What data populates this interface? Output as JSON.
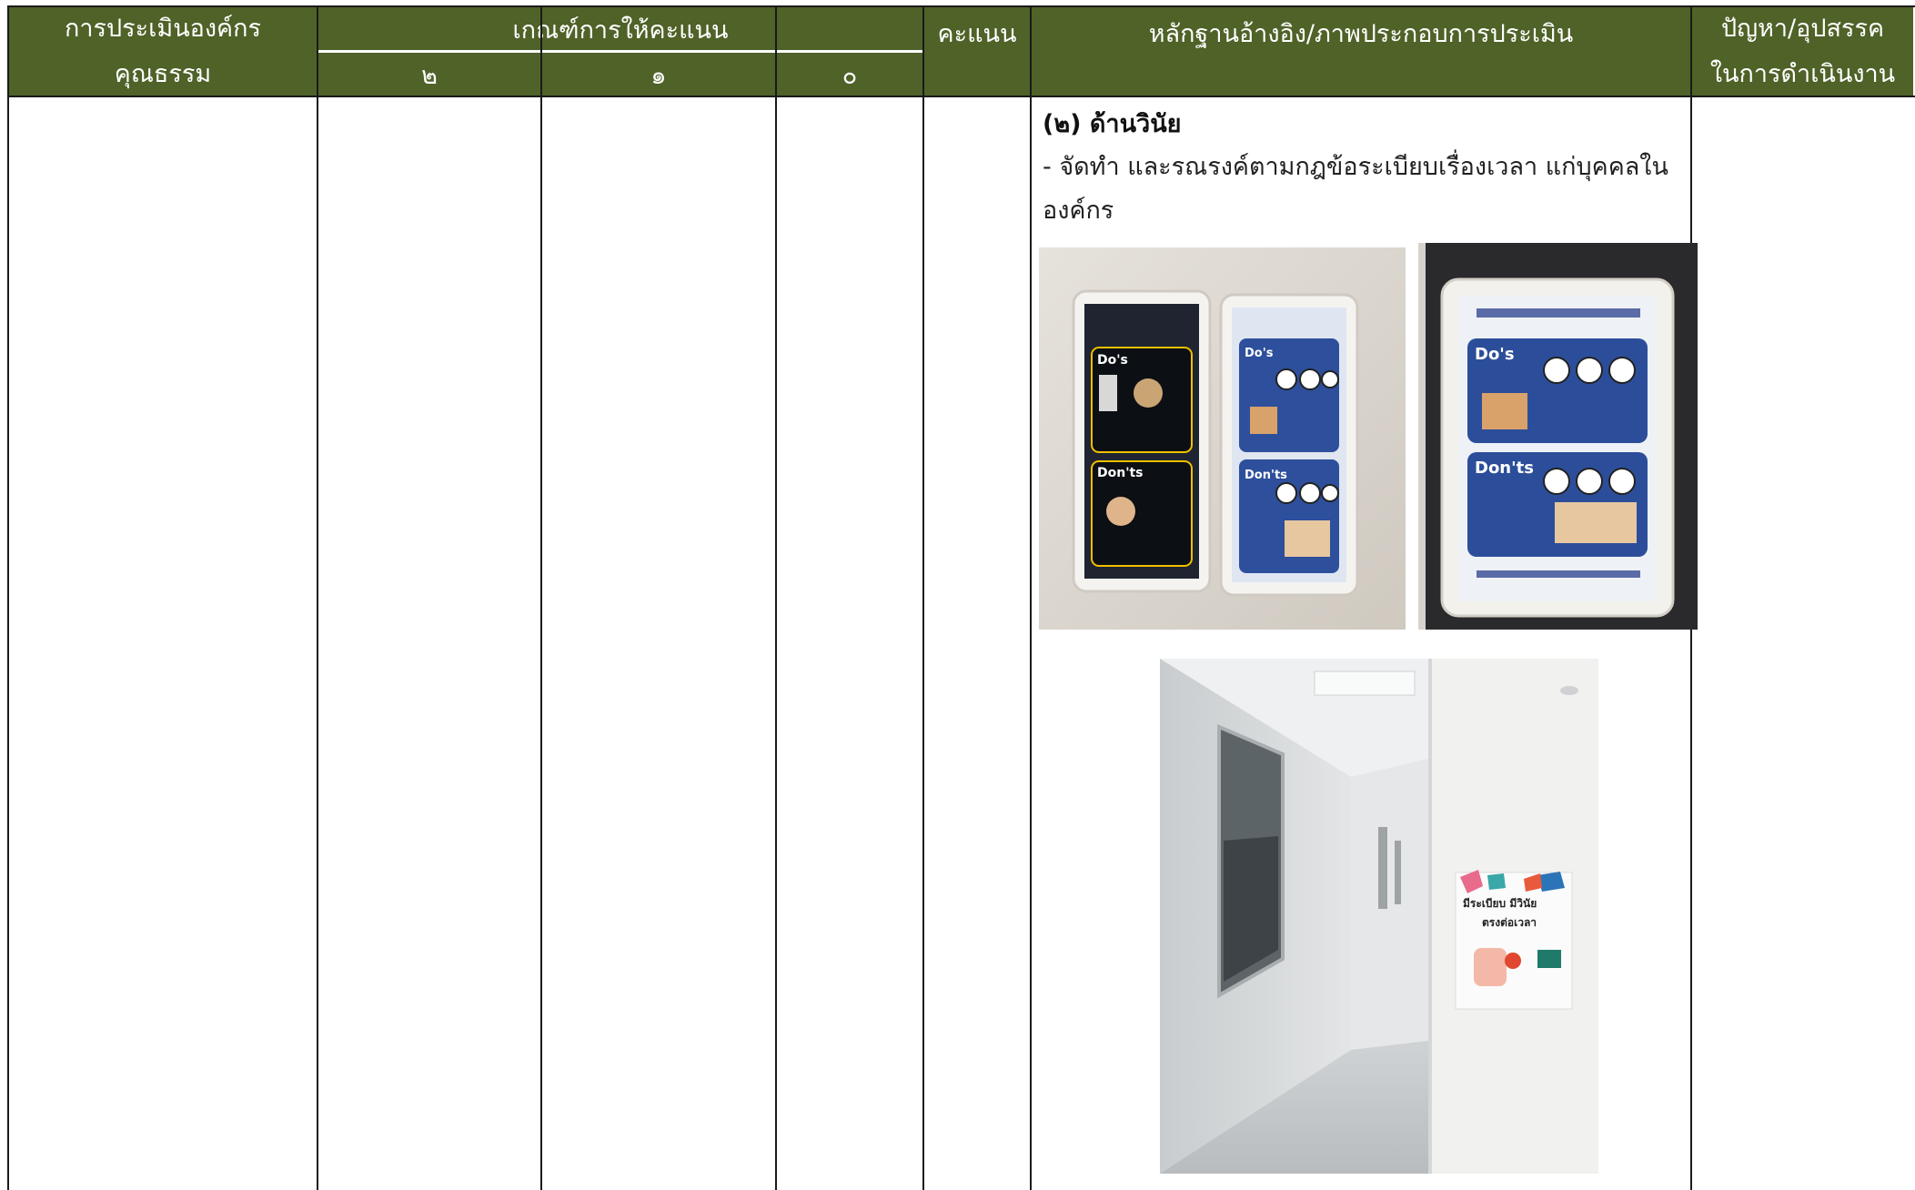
{
  "header": {
    "col_org_line1": "การประเมินองค์กร",
    "col_org_line2": "คุณธรรม",
    "col_criteria": "เกณฑ์การให้คะแนน",
    "col_score2": "๒",
    "col_score1": "๑",
    "col_score0": "๐",
    "col_points": "คะแนน",
    "col_evidence": "หลักฐานอ้างอิง/ภาพประกอบการประเมิน",
    "col_issues_line1": "ปัญหา/อุปสรรค",
    "col_issues_line2": "ในการดำเนินงาน"
  },
  "evidence": {
    "title": "(๒) ด้านวินัย",
    "text": "- จัดทำ และรณรงค์ตามกฎข้อระเบียบเรื่องเวลา แก่บุคคลในองค์กร"
  },
  "colors": {
    "header_bg": "#4f6228",
    "header_text": "#ffffff",
    "rule": "#1a1a1a"
  }
}
